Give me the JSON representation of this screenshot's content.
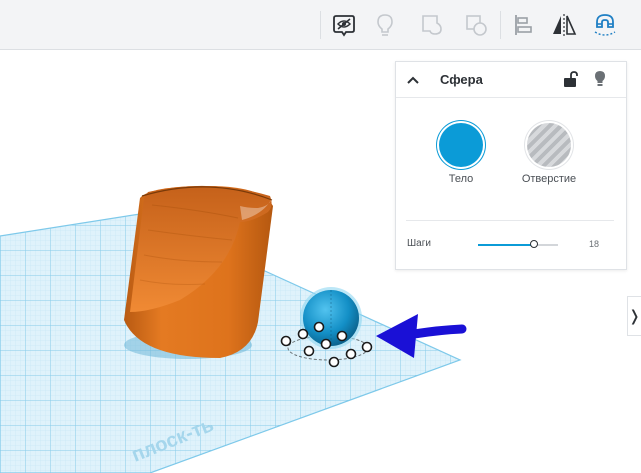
{
  "toolbar": {
    "buttons": [
      {
        "name": "show-all-icon",
        "active": true
      },
      {
        "name": "lightbulb-icon",
        "active": false
      },
      {
        "name": "group-icon",
        "active": false
      },
      {
        "name": "ungroup-icon",
        "active": false
      },
      {
        "name": "align-icon",
        "active": true
      },
      {
        "name": "mirror-icon",
        "active": true
      },
      {
        "name": "cruise-magnet-icon",
        "active": true
      }
    ]
  },
  "shape_panel": {
    "title": "Сфера",
    "lock_icon": "lock-open-icon",
    "visibility_icon": "lightbulb-icon",
    "solid_label": "Тело",
    "hole_label": "Отверстие",
    "steps_label": "Шаги",
    "steps_value": "18",
    "steps_fraction": 0.7,
    "solid_color": "#0b9bd7"
  },
  "workplane": {
    "watermark": "плоск-ть",
    "grid_color": "#7ec9ea"
  },
  "colors": {
    "cylinder": "#e87b22",
    "sphere": "#0b9bd7",
    "arrow": "#1a10d6"
  }
}
